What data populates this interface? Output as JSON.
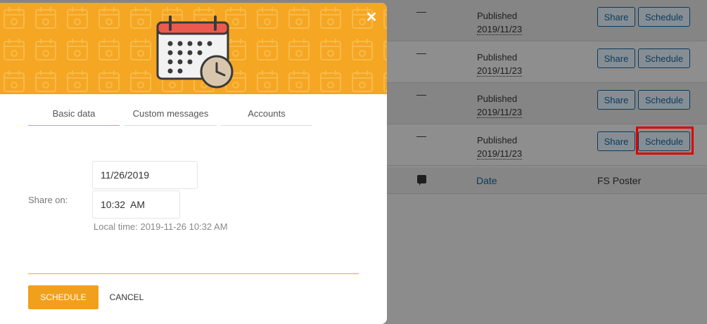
{
  "background": {
    "rows": [
      {
        "dash": "—",
        "status": "Published",
        "date": "2019/11/23",
        "share": "Share",
        "schedule": "Schedule"
      },
      {
        "dash": "—",
        "status": "Published",
        "date": "2019/11/23",
        "share": "Share",
        "schedule": "Schedule"
      },
      {
        "dash": "—",
        "status": "Published",
        "date": "2019/11/23",
        "share": "Share",
        "schedule": "Schedule"
      },
      {
        "dash": "—",
        "status": "Published",
        "date": "2019/11/23",
        "share": "Share",
        "schedule": "Schedule"
      }
    ],
    "footer": {
      "date_column": "Date",
      "fs_poster_column": "FS Poster"
    }
  },
  "modal": {
    "close_symbol": "✕",
    "tabs": [
      {
        "label": "Basic data",
        "active": true
      },
      {
        "label": "Custom messages",
        "active": false
      },
      {
        "label": "Accounts",
        "active": false
      }
    ],
    "share_on_label": "Share on:",
    "date_value": "11/26/2019",
    "time_value": "10:32  AM",
    "local_time": "Local time: 2019-11-26 10:32 AM",
    "schedule_button": "SCHEDULE",
    "cancel_button": "CANCEL"
  },
  "colors": {
    "accent": "#f0a01c",
    "header": "#f5a623",
    "highlight": "#e00000"
  },
  "icons": {
    "header_icon": "calendar-clock-icon",
    "close": "close-icon",
    "comment": "comment-icon"
  }
}
